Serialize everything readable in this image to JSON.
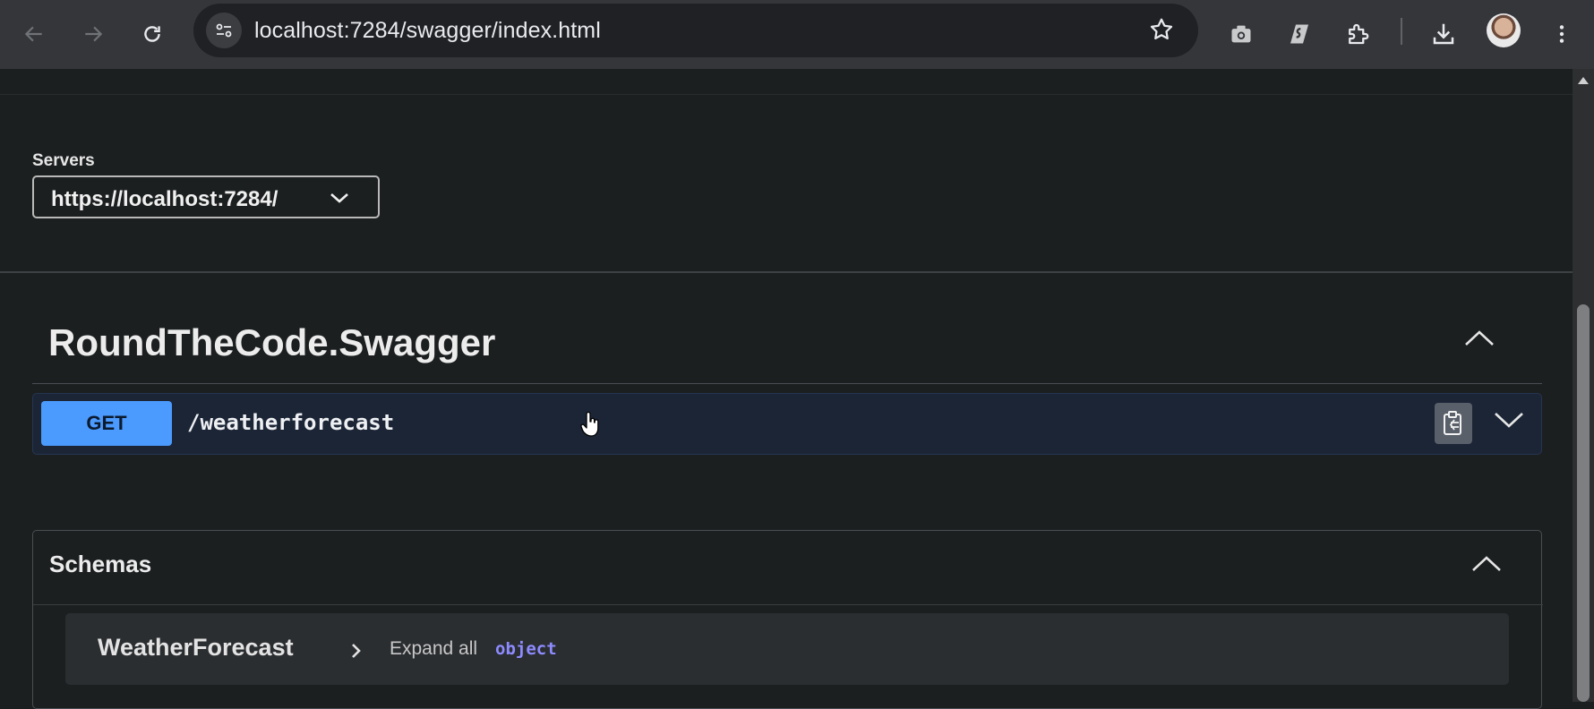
{
  "browser": {
    "url": "localhost:7284/swagger/index.html",
    "icons": [
      "back-arrow-icon",
      "forward-arrow-icon",
      "reload-icon",
      "site-settings-icon",
      "bookmark-star-icon",
      "camera-extension-icon",
      "surfshark-extension-icon",
      "extensions-puzzle-icon",
      "download-icon",
      "profile-avatar",
      "more-menu-icon"
    ]
  },
  "servers": {
    "label": "Servers",
    "selected": "https://localhost:7284/"
  },
  "api": {
    "title": "RoundTheCode.Swagger"
  },
  "operations": [
    {
      "method": "GET",
      "path": "/weatherforecast",
      "method_color": "#4b9bff"
    }
  ],
  "schemas": {
    "title": "Schemas",
    "models": [
      {
        "name": "WeatherForecast",
        "expand_label": "Expand all",
        "type": "object"
      }
    ]
  },
  "colors": {
    "background": "#1c1f20",
    "get_accent": "#4b9bff",
    "opblock_bg": "#1b2536",
    "type_text": "#8d8bff"
  }
}
